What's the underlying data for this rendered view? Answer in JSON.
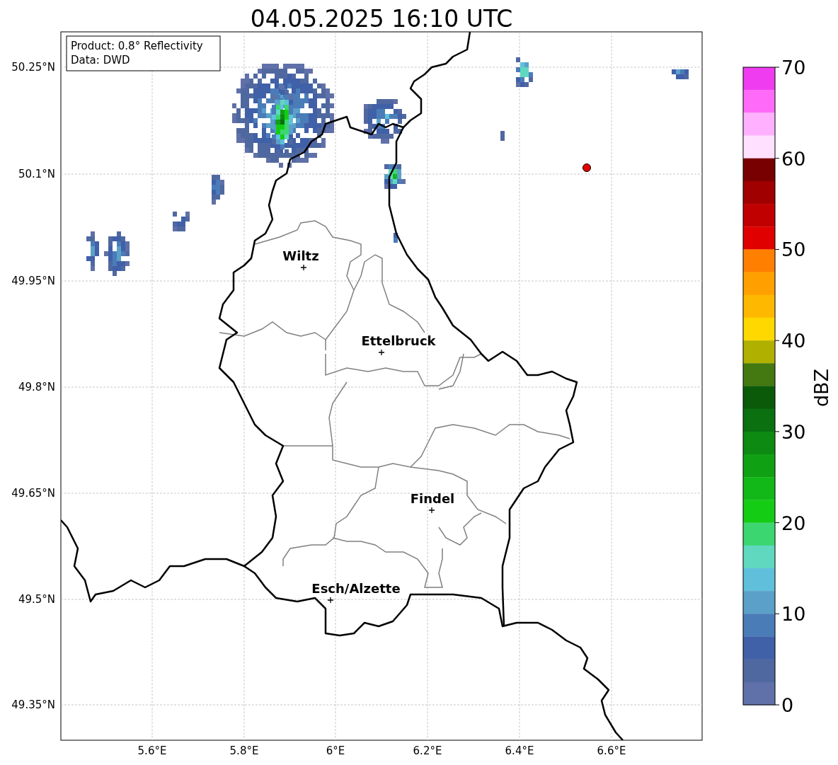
{
  "title": "04.05.2025 16:10 UTC",
  "legend": [
    "Product: 0.8° Reflectivity",
    "Data: DWD"
  ],
  "lat_labels": [
    "50.25°N",
    "50.1°N",
    "49.95°N",
    "49.8°N",
    "49.65°N",
    "49.5°N",
    "49.35°N"
  ],
  "lon_labels": [
    "5.6°E",
    "5.8°E",
    "6°E",
    "6.2°E",
    "6.4°E",
    "6.6°E"
  ],
  "cities": [
    {
      "name": "Wiltz"
    },
    {
      "name": "Ettelbruck"
    },
    {
      "name": "Findel"
    },
    {
      "name": "Esch/Alzette"
    }
  ],
  "colorbar": {
    "label": "dBZ",
    "ticks": [
      "70",
      "60",
      "50",
      "40",
      "30",
      "20",
      "10",
      "0"
    ],
    "segments": [
      {
        "color": "#f03cf0"
      },
      {
        "color": "#ff6af8"
      },
      {
        "color": "#ffb0ff"
      },
      {
        "color": "#ffe0ff"
      },
      {
        "color": "#780000"
      },
      {
        "color": "#a00000"
      },
      {
        "color": "#c00000"
      },
      {
        "color": "#e00000"
      },
      {
        "color": "#ff8000"
      },
      {
        "color": "#ffa000"
      },
      {
        "color": "#ffb800"
      },
      {
        "color": "#ffd800"
      },
      {
        "color": "#b0b000"
      },
      {
        "color": "#447810"
      },
      {
        "color": "#0a5a0a"
      },
      {
        "color": "#0a7010"
      },
      {
        "color": "#0c8a12"
      },
      {
        "color": "#10a014"
      },
      {
        "color": "#12b818"
      },
      {
        "color": "#14cc14"
      },
      {
        "color": "#3cd670"
      },
      {
        "color": "#60d8c0"
      },
      {
        "color": "#60c0dc"
      },
      {
        "color": "#5aa0c8"
      },
      {
        "color": "#4a7cb8"
      },
      {
        "color": "#4060a8"
      },
      {
        "color": "#5068a0"
      },
      {
        "color": "#6070a8"
      }
    ]
  }
}
